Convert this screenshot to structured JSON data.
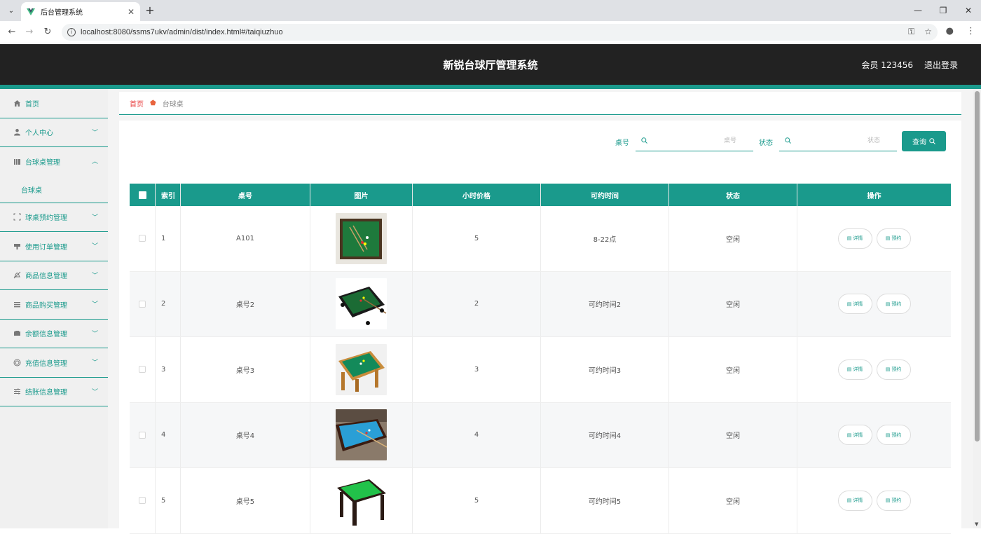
{
  "browser": {
    "tab_title": "后台管理系统",
    "url": "localhost:8080/ssms7ukv/admin/dist/index.html#/taiqiuzhuo"
  },
  "header": {
    "title": "新锐台球厅管理系统",
    "user": "会员 123456",
    "logout": "退出登录"
  },
  "sidebar": {
    "items": [
      {
        "label": "首页",
        "icon": "home-icon"
      },
      {
        "label": "个人中心",
        "icon": "user-icon"
      },
      {
        "label": "台球桌管理",
        "icon": "table-icon"
      },
      {
        "label": "台球桌",
        "icon": ""
      },
      {
        "label": "球桌预约管理",
        "icon": "calendar-icon"
      },
      {
        "label": "使用订单管理",
        "icon": "order-icon"
      },
      {
        "label": "商品信息管理",
        "icon": "bell-icon"
      },
      {
        "label": "商品购买管理",
        "icon": "list-icon"
      },
      {
        "label": "余额信息管理",
        "icon": "wallet-icon"
      },
      {
        "label": "充值信息管理",
        "icon": "coin-icon"
      },
      {
        "label": "结账信息管理",
        "icon": "sliders-icon"
      }
    ]
  },
  "breadcrumb": {
    "home": "首页",
    "current": "台球桌"
  },
  "search": {
    "table_no_label": "桌号",
    "table_no_placeholder": "桌号",
    "status_label": "状态",
    "status_placeholder": "状态",
    "query_button": "查询"
  },
  "table": {
    "columns": [
      "索引",
      "桌号",
      "图片",
      "小时价格",
      "可约时间",
      "状态",
      "操作"
    ],
    "rows": [
      {
        "index": "1",
        "table_no": "A101",
        "image": "green-pool-table-photo",
        "price": "5",
        "time": "8-22点",
        "status": "空闲"
      },
      {
        "index": "2",
        "table_no": "桌号2",
        "image": "dark-pool-table-photo",
        "price": "2",
        "time": "可约时间2",
        "status": "空闲"
      },
      {
        "index": "3",
        "table_no": "桌号3",
        "image": "wooden-pool-table-photo",
        "price": "3",
        "time": "可约时间3",
        "status": "空闲"
      },
      {
        "index": "4",
        "table_no": "桌号4",
        "image": "blue-pool-table-photo",
        "price": "4",
        "time": "可约时间4",
        "status": "空闲"
      },
      {
        "index": "5",
        "table_no": "桌号5",
        "image": "bright-green-pool-table-photo",
        "price": "5",
        "time": "可约时间5",
        "status": "空闲"
      }
    ],
    "detail_button": "详情",
    "reserve_button": "预约"
  }
}
